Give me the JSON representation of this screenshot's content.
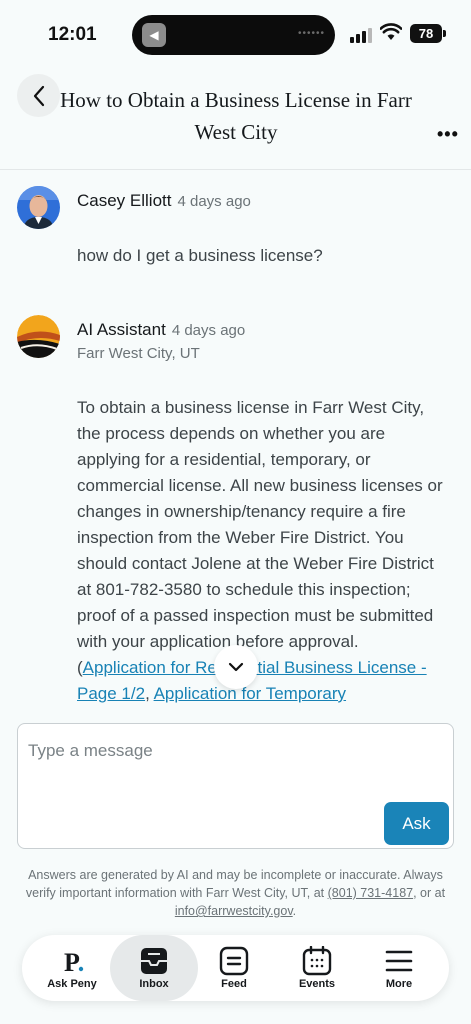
{
  "status": {
    "time": "12:01",
    "battery": "78"
  },
  "header": {
    "title": "How to Obtain a Business License in Farr West City"
  },
  "messages": [
    {
      "author": "Casey Elliott",
      "time": "4 days ago",
      "text": "how do I get a business license?"
    },
    {
      "author": "AI Assistant",
      "time": "4 days ago",
      "location": "Farr West City, UT",
      "text": "To obtain a business license in Farr West City, the process depends on whether you are applying for a residential, temporary, or commercial license. All new business licenses or changes in ownership/tenancy require a fire inspection from the Weber Fire District. You should contact Jolene at the Weber Fire District at 801-782-3580 to schedule this inspection; proof of a passed inspection must be submitted with your application before approval. (",
      "link1": "Application for Residential Business License - Page 1/2",
      "sep": ", ",
      "link2": "Application for Temporary"
    }
  ],
  "composer": {
    "placeholder": "Type a message",
    "ask_label": "Ask"
  },
  "disclaimer": {
    "prefix": "Answers are generated by AI and may be incomplete or inaccurate. Always verify important information with Farr West City, UT, at ",
    "phone": "(801) 731-4187",
    "middle": ", or at ",
    "email": "info@farrwestcity.gov",
    "suffix": "."
  },
  "tabs": [
    {
      "label": "Ask Peny",
      "icon": "peny-logo-icon",
      "active": false
    },
    {
      "label": "Inbox",
      "icon": "inbox-icon",
      "active": true
    },
    {
      "label": "Feed",
      "icon": "feed-icon",
      "active": false
    },
    {
      "label": "Events",
      "icon": "calendar-icon",
      "active": false
    },
    {
      "label": "More",
      "icon": "menu-icon",
      "active": false
    }
  ],
  "colors": {
    "accent": "#1a84b8",
    "link": "#1882b5",
    "background": "#f7fbfb"
  }
}
